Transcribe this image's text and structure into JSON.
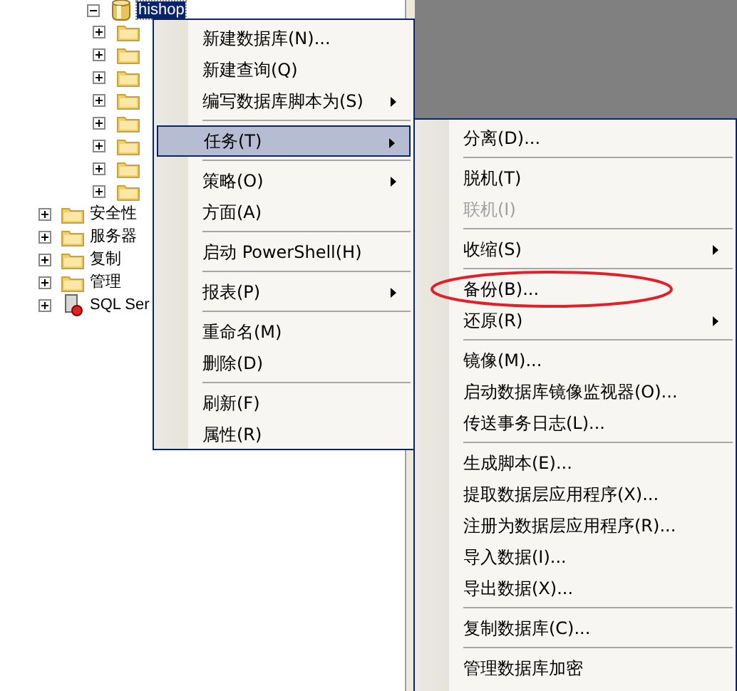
{
  "tree": {
    "database": {
      "label": "hishop",
      "selected": true,
      "expanded": true
    },
    "children": [
      {
        "expanded": false
      },
      {
        "expanded": false
      },
      {
        "expanded": false
      },
      {
        "expanded": false
      },
      {
        "expanded": false
      },
      {
        "expanded": false
      },
      {
        "expanded": false
      },
      {
        "expanded": false
      }
    ],
    "nodes": [
      {
        "label": "安全性",
        "kind": "folder",
        "expanded": false
      },
      {
        "label": "服务器",
        "kind": "folder",
        "expanded": false
      },
      {
        "label": "复制",
        "kind": "folder",
        "expanded": false
      },
      {
        "label": "管理",
        "kind": "folder",
        "expanded": false
      },
      {
        "label": "SQL Ser",
        "kind": "agent",
        "expanded": false
      }
    ]
  },
  "context_menu": [
    {
      "kind": "item",
      "label": "新建数据库(N)...",
      "submenu": false,
      "selected": false
    },
    {
      "kind": "item",
      "label": "新建查询(Q)",
      "submenu": false,
      "selected": false
    },
    {
      "kind": "item",
      "label": "编写数据库脚本为(S)",
      "submenu": true,
      "selected": false
    },
    {
      "kind": "separator"
    },
    {
      "kind": "item",
      "label": "任务(T)",
      "submenu": true,
      "selected": true
    },
    {
      "kind": "separator"
    },
    {
      "kind": "item",
      "label": "策略(O)",
      "submenu": true,
      "selected": false
    },
    {
      "kind": "item",
      "label": "方面(A)",
      "submenu": false,
      "selected": false
    },
    {
      "kind": "separator"
    },
    {
      "kind": "item",
      "label": "启动 PowerShell(H)",
      "submenu": false,
      "selected": false
    },
    {
      "kind": "separator"
    },
    {
      "kind": "item",
      "label": "报表(P)",
      "submenu": true,
      "selected": false
    },
    {
      "kind": "separator"
    },
    {
      "kind": "item",
      "label": "重命名(M)",
      "submenu": false,
      "selected": false
    },
    {
      "kind": "item",
      "label": "删除(D)",
      "submenu": false,
      "selected": false
    },
    {
      "kind": "separator"
    },
    {
      "kind": "item",
      "label": "刷新(F)",
      "submenu": false,
      "selected": false
    },
    {
      "kind": "item",
      "label": "属性(R)",
      "submenu": false,
      "selected": false
    }
  ],
  "tasks_submenu": [
    {
      "kind": "item",
      "label": "分离(D)...",
      "submenu": false,
      "disabled": false,
      "circled": false
    },
    {
      "kind": "separator"
    },
    {
      "kind": "item",
      "label": "脱机(T)",
      "submenu": false,
      "disabled": false,
      "circled": false
    },
    {
      "kind": "item",
      "label": "联机(I)",
      "submenu": false,
      "disabled": true,
      "circled": false
    },
    {
      "kind": "separator"
    },
    {
      "kind": "item",
      "label": "收缩(S)",
      "submenu": true,
      "disabled": false,
      "circled": false
    },
    {
      "kind": "separator"
    },
    {
      "kind": "item",
      "label": "备份(B)...",
      "submenu": false,
      "disabled": false,
      "circled": true
    },
    {
      "kind": "item",
      "label": "还原(R)",
      "submenu": true,
      "disabled": false,
      "circled": false
    },
    {
      "kind": "separator"
    },
    {
      "kind": "item",
      "label": "镜像(M)...",
      "submenu": false,
      "disabled": false,
      "circled": false
    },
    {
      "kind": "item",
      "label": "启动数据库镜像监视器(O)...",
      "submenu": false,
      "disabled": false,
      "circled": false
    },
    {
      "kind": "item",
      "label": "传送事务日志(L)...",
      "submenu": false,
      "disabled": false,
      "circled": false
    },
    {
      "kind": "separator"
    },
    {
      "kind": "item",
      "label": "生成脚本(E)...",
      "submenu": false,
      "disabled": false,
      "circled": false
    },
    {
      "kind": "item",
      "label": "提取数据层应用程序(X)...",
      "submenu": false,
      "disabled": false,
      "circled": false
    },
    {
      "kind": "item",
      "label": "注册为数据层应用程序(R)...",
      "submenu": false,
      "disabled": false,
      "circled": false
    },
    {
      "kind": "item",
      "label": "导入数据(I)...",
      "submenu": false,
      "disabled": false,
      "circled": false
    },
    {
      "kind": "item",
      "label": "导出数据(X)...",
      "submenu": false,
      "disabled": false,
      "circled": false
    },
    {
      "kind": "separator"
    },
    {
      "kind": "item",
      "label": "复制数据库(C)...",
      "submenu": false,
      "disabled": false,
      "circled": false
    },
    {
      "kind": "separator"
    },
    {
      "kind": "item",
      "label": "管理数据库加密",
      "submenu": false,
      "disabled": false,
      "circled": false
    }
  ]
}
